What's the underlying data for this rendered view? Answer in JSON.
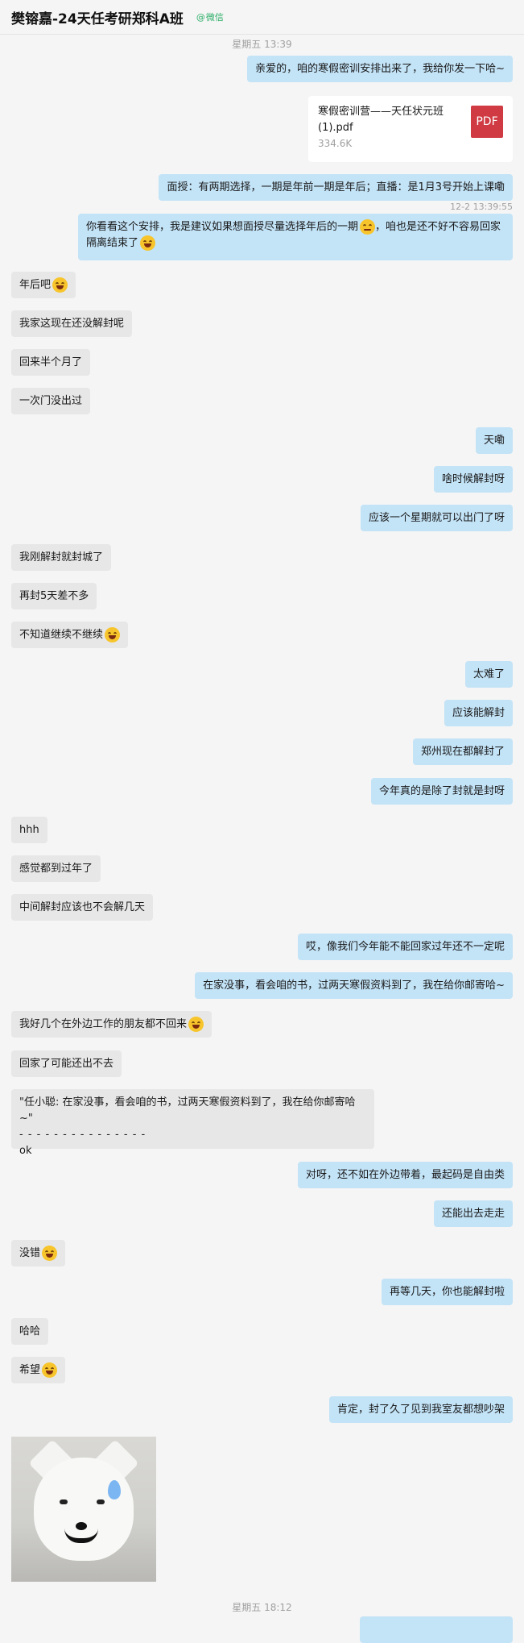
{
  "header": {
    "title": "樊镕嘉-24天任考研郑科A班",
    "tag": "微信"
  },
  "timestamps": [
    "星期五 13:39",
    "12-2 13:39:55",
    "星期五 18:12"
  ],
  "file": {
    "name": "寒假密训营——天任状元班(1).pdf",
    "size": "334.6K",
    "icon": "PDF"
  },
  "messages": [
    {
      "side": "out",
      "text": "亲爱的，咱的寒假密训安排出来了，我给你发一下哈~"
    },
    {
      "side": "out",
      "text": "面授：有两期选择，一期是年前一期是年后；直播：是1月3号开始上课嘞"
    },
    {
      "side": "out",
      "text": "你看看这个安排，我是建议如果想面授尽量选择年后的一期",
      "text2": "，咱也是还不好不容易回家隔离结束了"
    },
    {
      "side": "in",
      "text": "年后吧"
    },
    {
      "side": "in",
      "text": "我家这现在还没解封呢"
    },
    {
      "side": "in",
      "text": "回来半个月了"
    },
    {
      "side": "in",
      "text": "一次门没出过"
    },
    {
      "side": "out",
      "text": "天嘞"
    },
    {
      "side": "out",
      "text": "啥时候解封呀"
    },
    {
      "side": "out",
      "text": "应该一个星期就可以出门了呀"
    },
    {
      "side": "in",
      "text": "我刚解封就封城了"
    },
    {
      "side": "in",
      "text": "再封5天差不多"
    },
    {
      "side": "in",
      "text": "不知道继续不继续"
    },
    {
      "side": "out",
      "text": "太难了"
    },
    {
      "side": "out",
      "text": "应该能解封"
    },
    {
      "side": "out",
      "text": "郑州现在都解封了"
    },
    {
      "side": "out",
      "text": "今年真的是除了封就是封呀"
    },
    {
      "side": "in",
      "text": "hhh"
    },
    {
      "side": "in",
      "text": "感觉都到过年了"
    },
    {
      "side": "in",
      "text": "中间解封应该也不会解几天"
    },
    {
      "side": "out",
      "text": "哎，像我们今年能不能回家过年还不一定呢"
    },
    {
      "side": "out",
      "text": "在家没事，看会咱的书，过两天寒假资料到了，我在给你邮寄哈~"
    },
    {
      "side": "in",
      "text": "我好几个在外边工作的朋友都不回来"
    },
    {
      "side": "in",
      "text": "回家了可能还出不去"
    },
    {
      "side": "in",
      "quote": "\"任小聪: 在家没事，看会咱的书，过两天寒假资料到了，我在给你邮寄哈~\"",
      "dashes": "- - - - - - - - - - - - - - -",
      "text": "ok"
    },
    {
      "side": "out",
      "text": "对呀，还不如在外边带着，最起码是自由类"
    },
    {
      "side": "out",
      "text": "还能出去走走"
    },
    {
      "side": "in",
      "text": "没错"
    },
    {
      "side": "out",
      "text": "再等几天，你也能解封啦"
    },
    {
      "side": "in",
      "text": "哈哈"
    },
    {
      "side": "in",
      "text": "希望"
    },
    {
      "side": "out",
      "text": "肯定，封了久了见到我室友都想吵架"
    }
  ],
  "icons": {
    "emoji": "laughing-face-icon",
    "emoji_neutral": "grimace-face-icon",
    "file": "pdf-icon"
  },
  "colors": {
    "incoming_bubble": "#e7e7e7",
    "outgoing_bubble": "#c3e3f7",
    "background": "#f5f5f5",
    "tag": "#2aae67",
    "pdf": "#d03a42"
  }
}
